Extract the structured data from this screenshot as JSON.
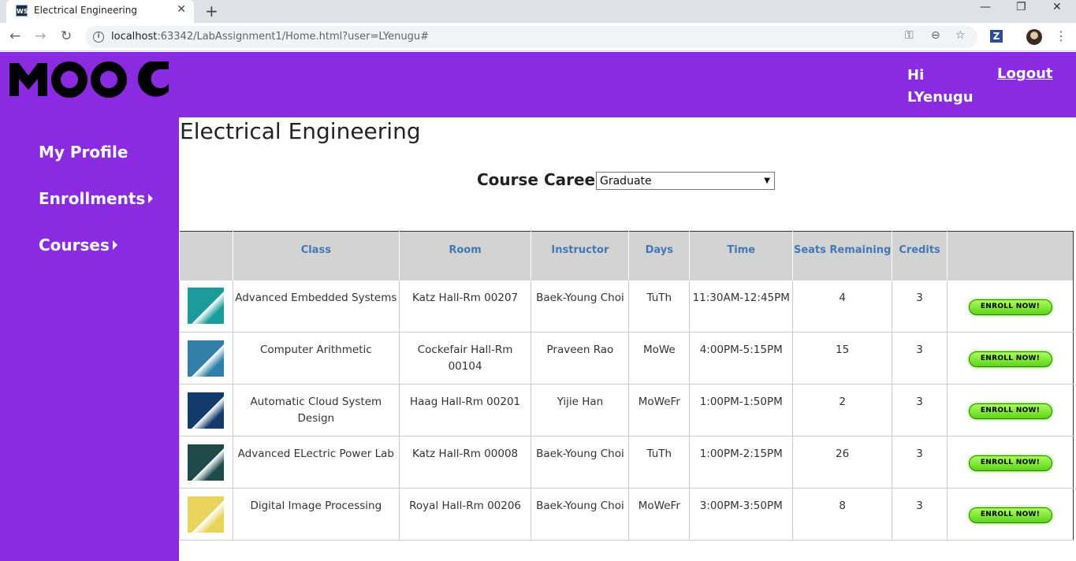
{
  "browser": {
    "tab_title": "Electrical Engineering",
    "favicon_text": "WS",
    "url_host": "localhost",
    "url_rest": ":63342/LabAssignment1/Home.html?user=LYenugu#"
  },
  "header": {
    "logo_text": "MOOC",
    "greeting_line1": "Hi",
    "greeting_line2": "LYenugu",
    "logout_label": "Logout",
    "brand_color": "#8a2be2"
  },
  "sidebar": {
    "items": [
      {
        "label": "My Profile",
        "has_caret": false
      },
      {
        "label": "Enrollments",
        "has_caret": true
      },
      {
        "label": "Courses",
        "has_caret": true
      }
    ]
  },
  "main": {
    "title": "Electrical Engineering",
    "career_label": "Course Career:",
    "career_selected": "Graduate"
  },
  "table": {
    "headers": [
      "",
      "Class",
      "Room",
      "Instructor",
      "Days",
      "Time",
      "Seats Remaining",
      "Credits",
      ""
    ],
    "rows": [
      {
        "thumb_color": "#1b9b9b",
        "class": "Advanced Embedded Systems",
        "room": "Katz Hall-Rm 00207",
        "instructor": "Baek-Young Choi",
        "days": "TuTh",
        "time": "11:30AM-12:45PM",
        "seats": "4",
        "credits": "3",
        "button": "ENROLL NOW!"
      },
      {
        "thumb_color": "#2f7fa8",
        "class": "Computer Arithmetic",
        "room": "Cockefair Hall-Rm 00104",
        "instructor": "Praveen Rao",
        "days": "MoWe",
        "time": "4:00PM-5:15PM",
        "seats": "15",
        "credits": "3",
        "button": "ENROLL NOW!"
      },
      {
        "thumb_color": "#123a6b",
        "class": "Automatic Cloud System Design",
        "room": "Haag Hall-Rm 00201",
        "instructor": "Yijie Han",
        "days": "MoWeFr",
        "time": "1:00PM-1:50PM",
        "seats": "2",
        "credits": "3",
        "button": "ENROLL NOW!"
      },
      {
        "thumb_color": "#1e4a4a",
        "class": "Advanced ELectric Power Lab",
        "room": "Katz Hall-Rm 00008",
        "instructor": "Baek-Young Choi",
        "days": "TuTh",
        "time": "1:00PM-2:15PM",
        "seats": "26",
        "credits": "3",
        "button": "ENROLL NOW!"
      },
      {
        "thumb_color": "#e8d45a",
        "class": "Digital Image Processing",
        "room": "Royal Hall-Rm 00206",
        "instructor": "Baek-Young Choi",
        "days": "MoWeFr",
        "time": "3:00PM-3:50PM",
        "seats": "8",
        "credits": "3",
        "button": "ENROLL NOW!"
      }
    ]
  }
}
